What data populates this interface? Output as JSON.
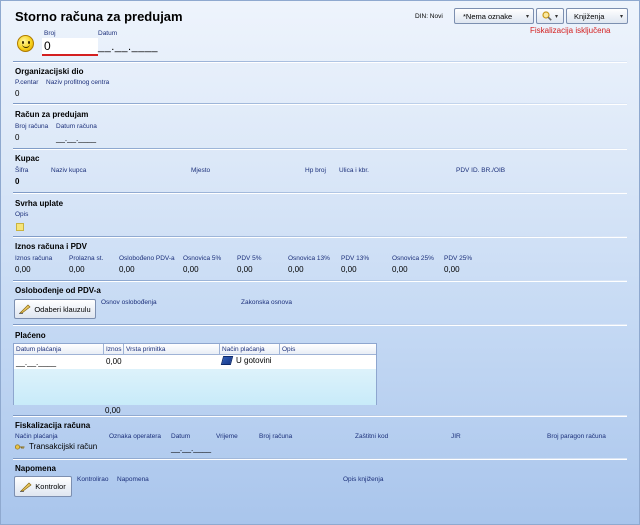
{
  "header": {
    "title": "Storno računa za predujam",
    "din_label": "DIN: Novi",
    "oznake_dropdown": "*Nema oznake",
    "knjizenja_button": "Knjiženja",
    "fiscal_status": "Fiskalizacija isključena",
    "broj_label": "Broj",
    "broj_value": "0",
    "datum_label": "Datum",
    "datum_value": "__.__.____"
  },
  "organizacijski": {
    "title": "Organizacijski dio",
    "pcentar_label": "P.centar",
    "naziv_label": "Naziv profitnog centra",
    "pcentar_value": "0"
  },
  "racun": {
    "title": "Račun za predujam",
    "broj_label": "Broj računa",
    "datum_label": "Datum računa",
    "broj_value": "0",
    "datum_value": "__.__.____"
  },
  "kupac": {
    "title": "Kupac",
    "sifra_label": "Šifra",
    "naziv_label": "Naziv kupca",
    "mjesto_label": "Mjesto",
    "hpbroj_label": "Hp broj",
    "ulica_label": "Ulica i kbr.",
    "pdvid_label": "PDV ID. BR./OIB",
    "sifra_value": "0"
  },
  "svrha": {
    "title": "Svrha uplate",
    "opis_label": "Opis"
  },
  "iznos": {
    "title": "Iznos računa i PDV",
    "columns": [
      {
        "label": "Iznos računa",
        "value": "0,00"
      },
      {
        "label": "Prolazna st.",
        "value": "0,00"
      },
      {
        "label": "Oslobođeno PDV-a",
        "value": "0,00"
      },
      {
        "label": "Osnovica 5%",
        "value": "0,00"
      },
      {
        "label": "PDV 5%",
        "value": "0,00"
      },
      {
        "label": "Osnovica 13%",
        "value": "0,00"
      },
      {
        "label": "PDV 13%",
        "value": "0,00"
      },
      {
        "label": "Osnovica 25%",
        "value": "0,00"
      },
      {
        "label": "PDV 25%",
        "value": "0,00"
      }
    ]
  },
  "oslobodenje": {
    "title": "Oslobođenje od PDV-a",
    "button": "Odaberi klauzulu",
    "osnov_label": "Osnov oslobođenja",
    "zakonska_label": "Zakonska osnova"
  },
  "placeno": {
    "title": "Plaćeno",
    "columns": [
      "Datum plaćanja",
      "Iznos",
      "Vrsta primitka",
      "Način plaćanja",
      "Opis"
    ],
    "row": {
      "datum": "__.__.____",
      "iznos": "0,00",
      "vrsta": "",
      "nacin": "U gotovini",
      "opis": ""
    },
    "total": "0,00"
  },
  "fiskalizacija": {
    "title": "Fiskalizacija računa",
    "nacin_label": "Način plaćanja",
    "oznaka_label": "Oznaka operatera",
    "datum_label": "Datum",
    "vrijeme_label": "Vrijeme",
    "broj_label": "Broj računa",
    "zastitni_label": "Zaštitni kod",
    "jir_label": "JIR",
    "paragon_label": "Broj paragon računa",
    "nacin_value": "Transakcijski račun",
    "datum_value": "__.__.____"
  },
  "napomena": {
    "title": "Napomena",
    "button": "Kontrolor",
    "kontrolirao_label": "Kontrolirao",
    "napomena_label": "Napomena",
    "opis_label": "Opis knjiženja"
  },
  "colors": {
    "accent": "#1b2f7a",
    "fiscal_red": "#d42020",
    "input_underline": "#d42020"
  }
}
